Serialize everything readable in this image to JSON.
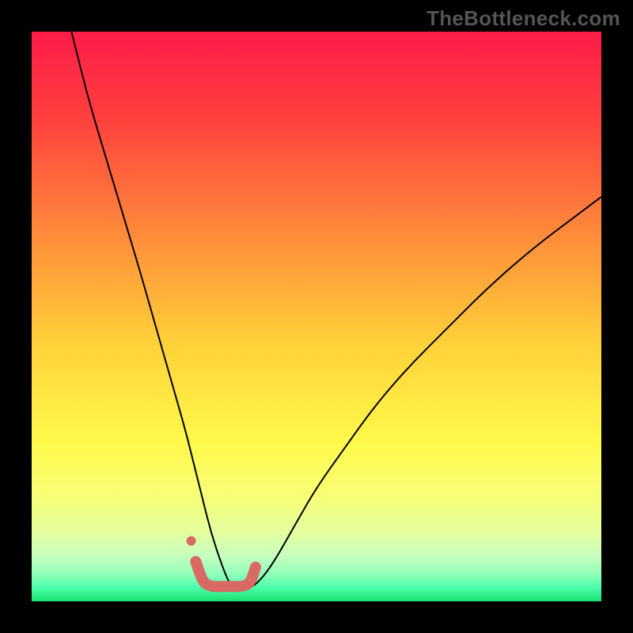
{
  "watermark": "TheBottleneck.com",
  "chart_data": {
    "type": "line",
    "title": "",
    "xlabel": "",
    "ylabel": "",
    "xlim": [
      0,
      100
    ],
    "ylim": [
      0,
      100
    ],
    "gradient_stops": [
      {
        "offset": 0.0,
        "color": "#ff1c49"
      },
      {
        "offset": 0.15,
        "color": "#ff3f3e"
      },
      {
        "offset": 0.35,
        "color": "#ff893b"
      },
      {
        "offset": 0.55,
        "color": "#ffd23a"
      },
      {
        "offset": 0.72,
        "color": "#fff94a"
      },
      {
        "offset": 0.82,
        "color": "#f6ff79"
      },
      {
        "offset": 0.88,
        "color": "#e4ffa0"
      },
      {
        "offset": 0.92,
        "color": "#c7ffbf"
      },
      {
        "offset": 0.955,
        "color": "#8bffb9"
      },
      {
        "offset": 0.975,
        "color": "#4dffad"
      },
      {
        "offset": 1.0,
        "color": "#18e06f"
      }
    ],
    "series": [
      {
        "name": "bottleneck-curve",
        "color": "#000000",
        "width": 2,
        "x": [
          7.0,
          10,
          13,
          16,
          19,
          21,
          23,
          25,
          27,
          28.5,
          30,
          31.5,
          33.5,
          35,
          37,
          39,
          42,
          46,
          50,
          55,
          60,
          66,
          73,
          80,
          88,
          96,
          100
        ],
        "values": [
          100,
          88,
          78,
          68,
          58,
          51,
          44,
          37,
          30,
          24,
          18,
          12,
          6,
          2.5,
          2.2,
          2.5,
          6,
          13,
          20,
          27,
          34,
          41,
          48,
          55,
          62,
          68,
          71
        ]
      },
      {
        "name": "flat-marker",
        "color": "#d96a63",
        "width": 14,
        "linecap": "round",
        "x": [
          28.8,
          30,
          31,
          32,
          33.3,
          35,
          37,
          38.4,
          39.3
        ],
        "values": [
          7.0,
          3.5,
          2.8,
          2.6,
          2.6,
          2.6,
          2.6,
          3.2,
          6.0
        ]
      }
    ],
    "dots": [
      {
        "name": "marker-dot",
        "x": 28.0,
        "y": 10.6,
        "r": 6,
        "color": "#d96a63"
      }
    ]
  }
}
